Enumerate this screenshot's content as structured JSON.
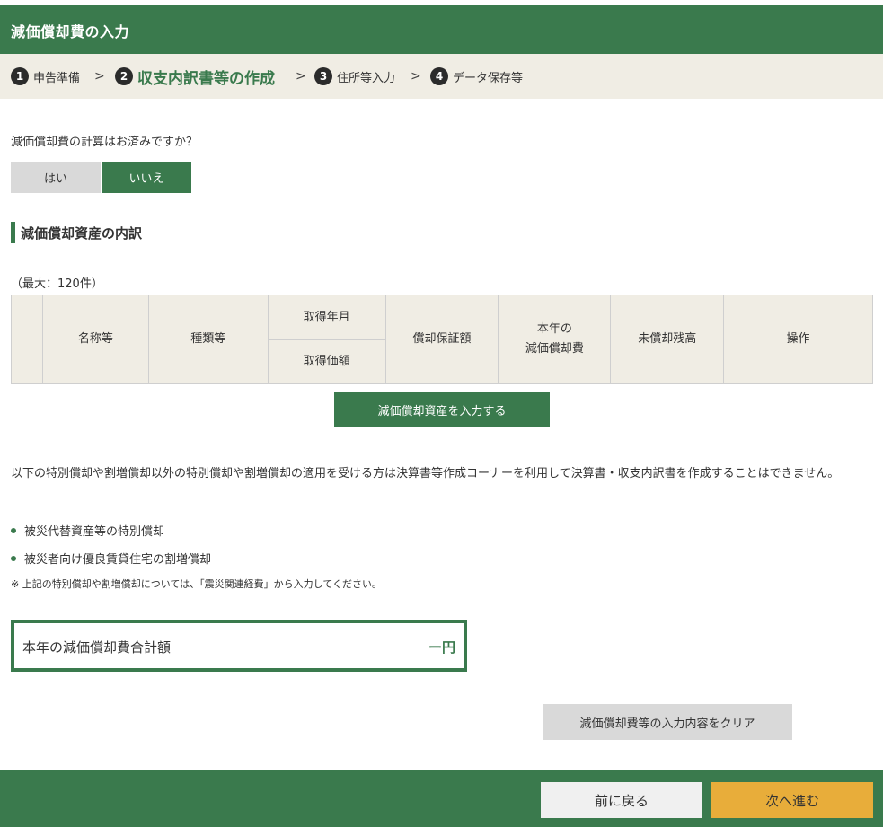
{
  "header": {
    "title": "減価償却費の入力"
  },
  "steps": [
    {
      "num": "1",
      "label": "申告準備"
    },
    {
      "num": "2",
      "label": "収支内訳書等の作成"
    },
    {
      "num": "3",
      "label": "住所等入力"
    },
    {
      "num": "4",
      "label": "データ保存等"
    }
  ],
  "step_separator": ">",
  "question": "減価償却費の計算はお済みですか？",
  "toggle": {
    "yes": "はい",
    "no": "いいえ",
    "selected": "いいえ"
  },
  "section_title": "減価償却資産の内訳",
  "max_note": "（最大：120件）",
  "table": {
    "headers": {
      "name": "名称等",
      "type": "種類等",
      "acq_date": "取得年月",
      "acq_price": "取得価額",
      "guarantee": "償却保証額",
      "current_dep_line1": "本年の",
      "current_dep_line2": "減価償却費",
      "balance": "未償却残高",
      "ops": "操作"
    }
  },
  "add_button": "減価償却資産を入力する",
  "info_text": "以下の特別償却や割増償却以外の特別償却や割増償却の適用を受ける方は決算書等作成コーナーを利用して決算書・収支内訳書を作成することはできません。",
  "bullets": [
    "被災代替資産等の特別償却",
    "被災者向け優良賃貸住宅の割増償却"
  ],
  "footnote": "※ 上記の特別償却や割増償却については、「震災関連経費」から入力してください。",
  "total": {
    "label": "本年の減価償却費合計額",
    "value": "ー円"
  },
  "clear_button": "減価償却費等の入力内容をクリア",
  "footer": {
    "back": "前に戻る",
    "next": "次へ進む"
  },
  "colors": {
    "primary": "#3a7a4d",
    "accent": "#e8ad3a",
    "step_bg": "#f0ede4"
  }
}
